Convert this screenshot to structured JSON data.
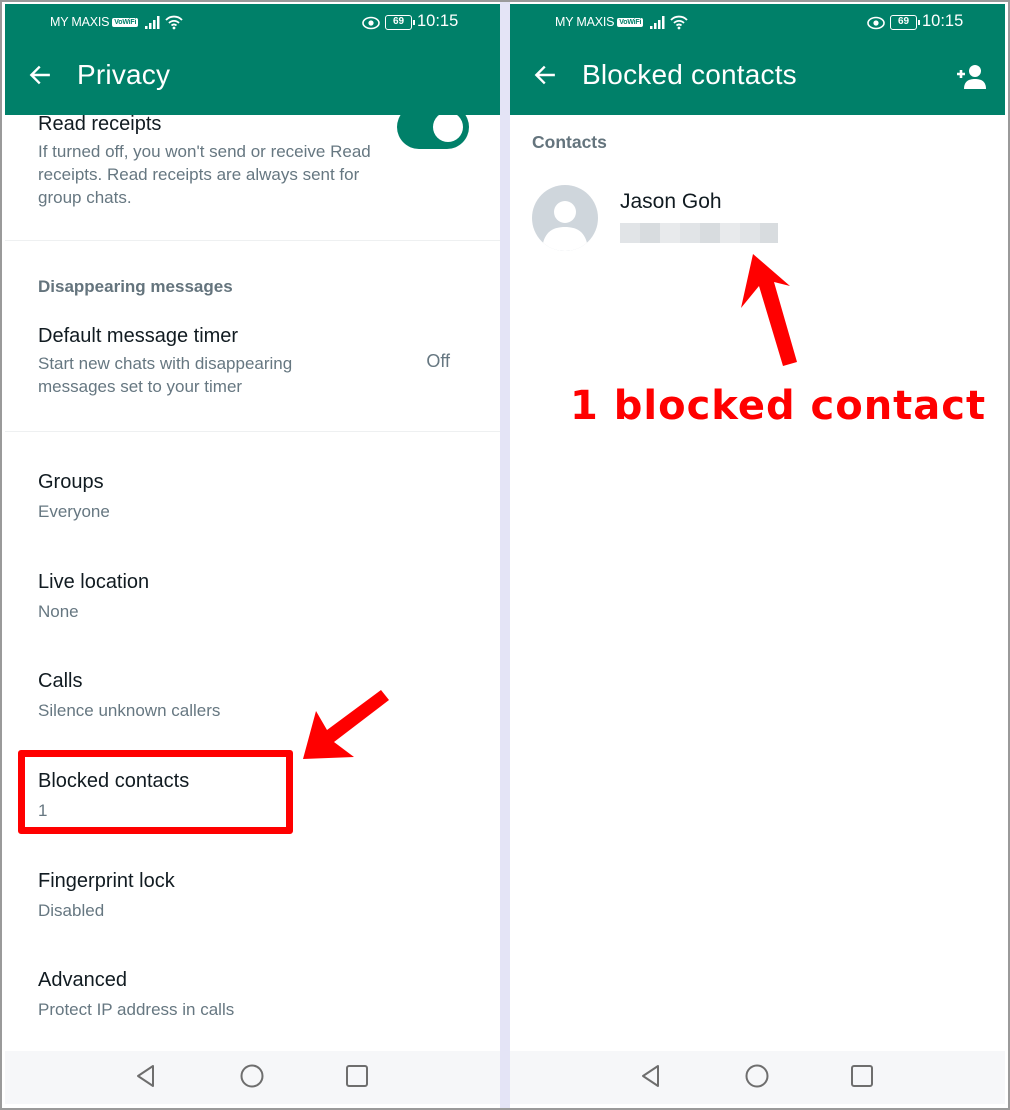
{
  "status_bar": {
    "carrier": "MY MAXIS",
    "vowifi_badge": "VoWiFi",
    "battery": "69",
    "time": "10:15"
  },
  "left_screen": {
    "title": "Privacy",
    "read_receipts": {
      "title": "Read receipts",
      "description": "If turned off, you won't send or receive Read receipts. Read receipts are always sent for group chats.",
      "enabled": true
    },
    "disappearing_section": "Disappearing messages",
    "default_timer": {
      "title": "Default message timer",
      "description": "Start new chats with disappearing messages set to your timer",
      "value": "Off"
    },
    "items": [
      {
        "title": "Groups",
        "value": "Everyone"
      },
      {
        "title": "Live location",
        "value": "None"
      },
      {
        "title": "Calls",
        "value": "Silence unknown callers"
      },
      {
        "title": "Blocked contacts",
        "value": "1"
      },
      {
        "title": "Fingerprint lock",
        "value": "Disabled"
      },
      {
        "title": "Advanced",
        "value": "Protect IP address in calls"
      }
    ]
  },
  "right_screen": {
    "title": "Blocked contacts",
    "section": "Contacts",
    "contacts": [
      {
        "name": "Jason Goh",
        "subtitle_redacted": true
      }
    ]
  },
  "annotations": {
    "label": "1 blocked contact",
    "color": "#ff0000"
  },
  "colors": {
    "brand": "#008069",
    "divider": "#e4e4f6"
  }
}
